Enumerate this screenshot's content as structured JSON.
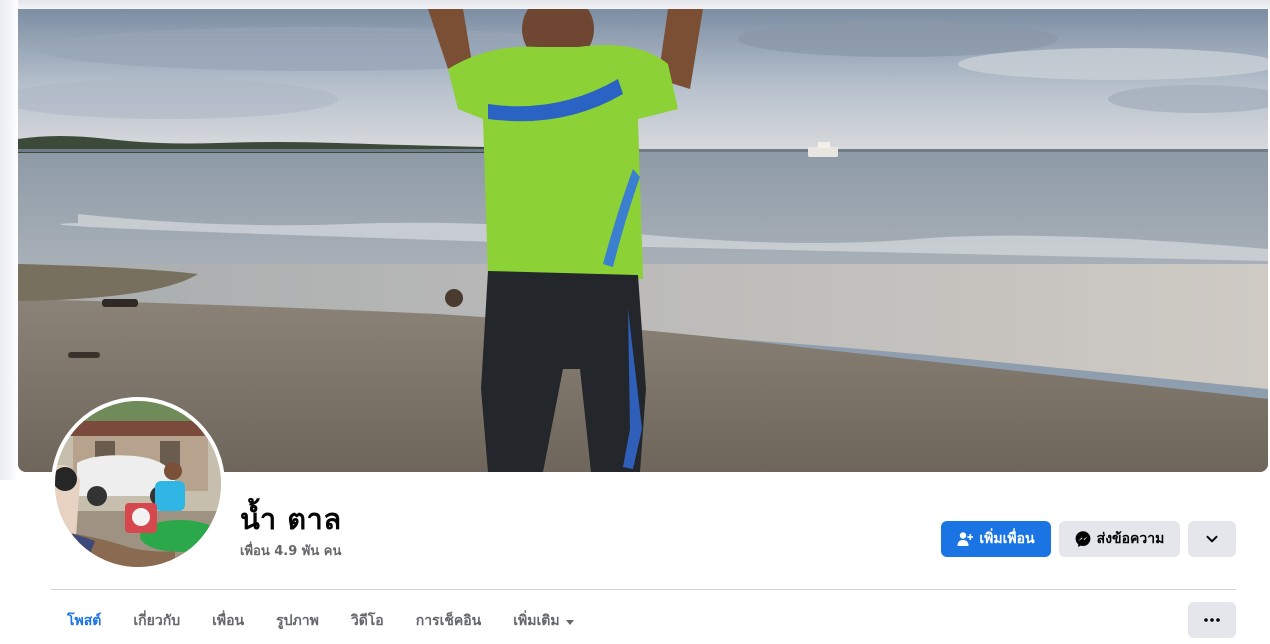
{
  "profile": {
    "name": "น้ำ ตาล",
    "friends": "เพื่อน 4.9 พัน คน"
  },
  "actions": {
    "add_friend": "เพิ่มเพื่อน",
    "message": "ส่งข้อความ"
  },
  "tabs": [
    {
      "label": "โพสต์",
      "active": true
    },
    {
      "label": "เกี่ยวกับ",
      "active": false
    },
    {
      "label": "เพื่อน",
      "active": false
    },
    {
      "label": "รูปภาพ",
      "active": false
    },
    {
      "label": "วิดีโอ",
      "active": false
    },
    {
      "label": "การเช็คอิน",
      "active": false
    },
    {
      "label": "เพิ่มเติม",
      "active": false
    }
  ],
  "icons": {
    "add_friend": "person-plus-icon",
    "message": "messenger-icon",
    "dropdown": "chevron-down-icon",
    "more": "ellipsis-icon",
    "tab_more": "caret-down-icon"
  },
  "colors": {
    "accent": "#1b74e4",
    "secondary_button": "#e4e6eb",
    "muted_text": "#65676b",
    "text": "#050505"
  }
}
